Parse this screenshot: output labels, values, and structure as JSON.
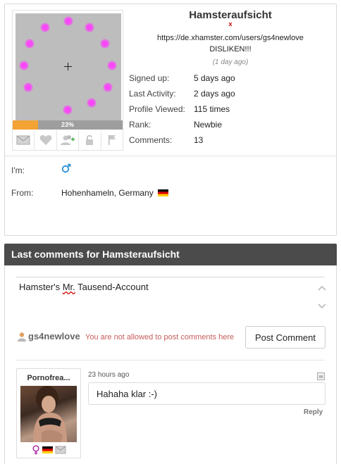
{
  "profile": {
    "username": "Hamsteraufsicht",
    "x_mark": "x",
    "status_url": "https://de.xhamster.com/users/gs4newlove",
    "status_text": "DISLIKEN!!!",
    "status_time": "(1 day ago)",
    "progress_label": "23%",
    "progress_fraction": 0.23,
    "accent_color": "#f3a234",
    "stats": [
      {
        "label": "Signed up:",
        "value": "5 days ago"
      },
      {
        "label": "Last Activity:",
        "value": "2 days ago"
      },
      {
        "label": "Profile Viewed:",
        "value": "115 times"
      },
      {
        "label": "Rank:",
        "value": "Newbie"
      },
      {
        "label": "Comments:",
        "value": "13"
      }
    ],
    "actions": [
      "mail-icon",
      "heart-icon",
      "add-friend-icon",
      "lock-icon",
      "flag-icon"
    ],
    "im_label": "I'm:",
    "gender_icon": "male-icon",
    "from_label": "From:",
    "from_value": "Hohenhameln, Germany",
    "from_flag": "germany-flag-icon"
  },
  "comments": {
    "header": "Last comments for Hamsteraufsicht",
    "editor_before": "Hamster's ",
    "editor_misspelled": "Mr.",
    "editor_after": " Tausend-Account",
    "poster_name": "gs4newlove",
    "notice": "You are not allowed to post comments here",
    "post_button": "Post Comment",
    "items": [
      {
        "author": "Pornofrea...",
        "time": "23 hours ago",
        "text": "Hahaha klar :-)",
        "reply": "Reply"
      }
    ]
  }
}
